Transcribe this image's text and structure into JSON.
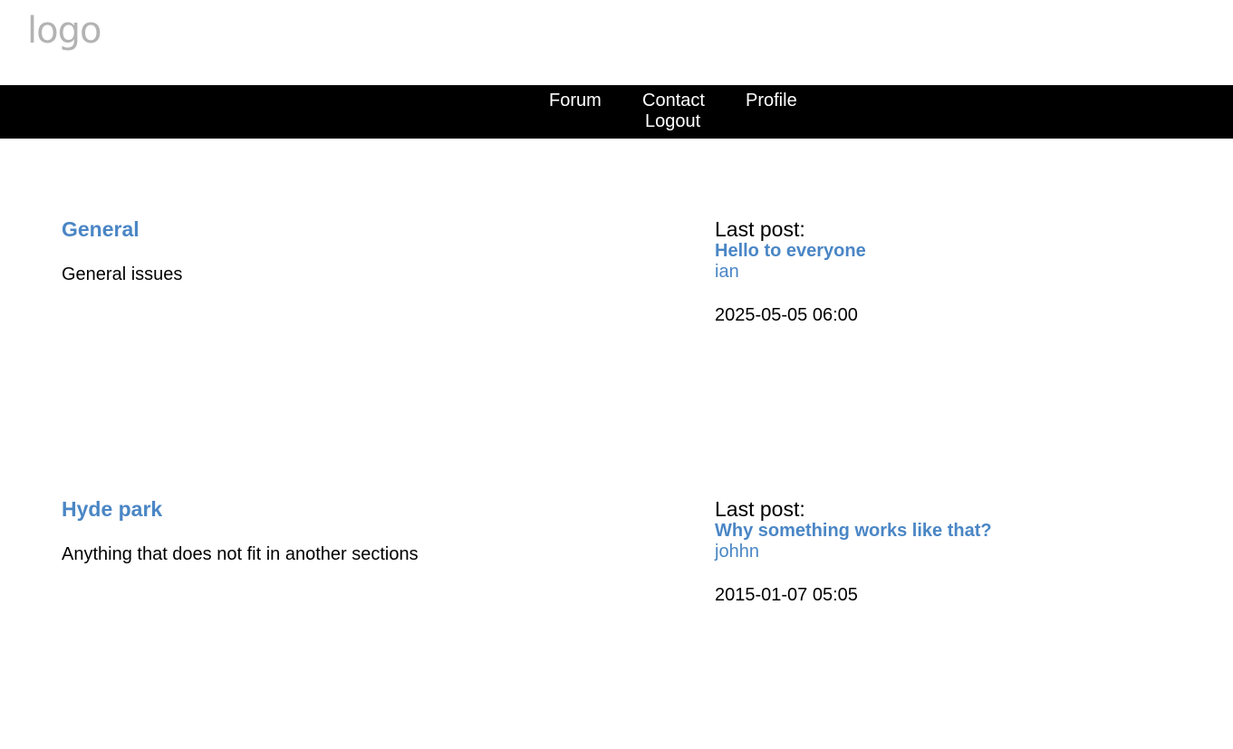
{
  "header": {
    "logo_text": "logo"
  },
  "nav": {
    "forum": "Forum",
    "contact": "Contact",
    "profile": "Profile",
    "logout": "Logout"
  },
  "sections": [
    {
      "title": "General",
      "description": "General issues",
      "last_post_label": "Last post:",
      "last_post_title": "Hello to everyone",
      "last_post_user": "ian",
      "last_post_date": "2025-05-05 06:00"
    },
    {
      "title": "Hyde park",
      "description": "Anything that does not fit in another sections",
      "last_post_label": "Last post:",
      "last_post_title": "Why something works like that?",
      "last_post_user": "johhn",
      "last_post_date": "2015-01-07 05:05"
    }
  ],
  "colors": {
    "link": "#4a86c5",
    "nav_bg": "#000000",
    "logo": "#b3b3b3"
  }
}
